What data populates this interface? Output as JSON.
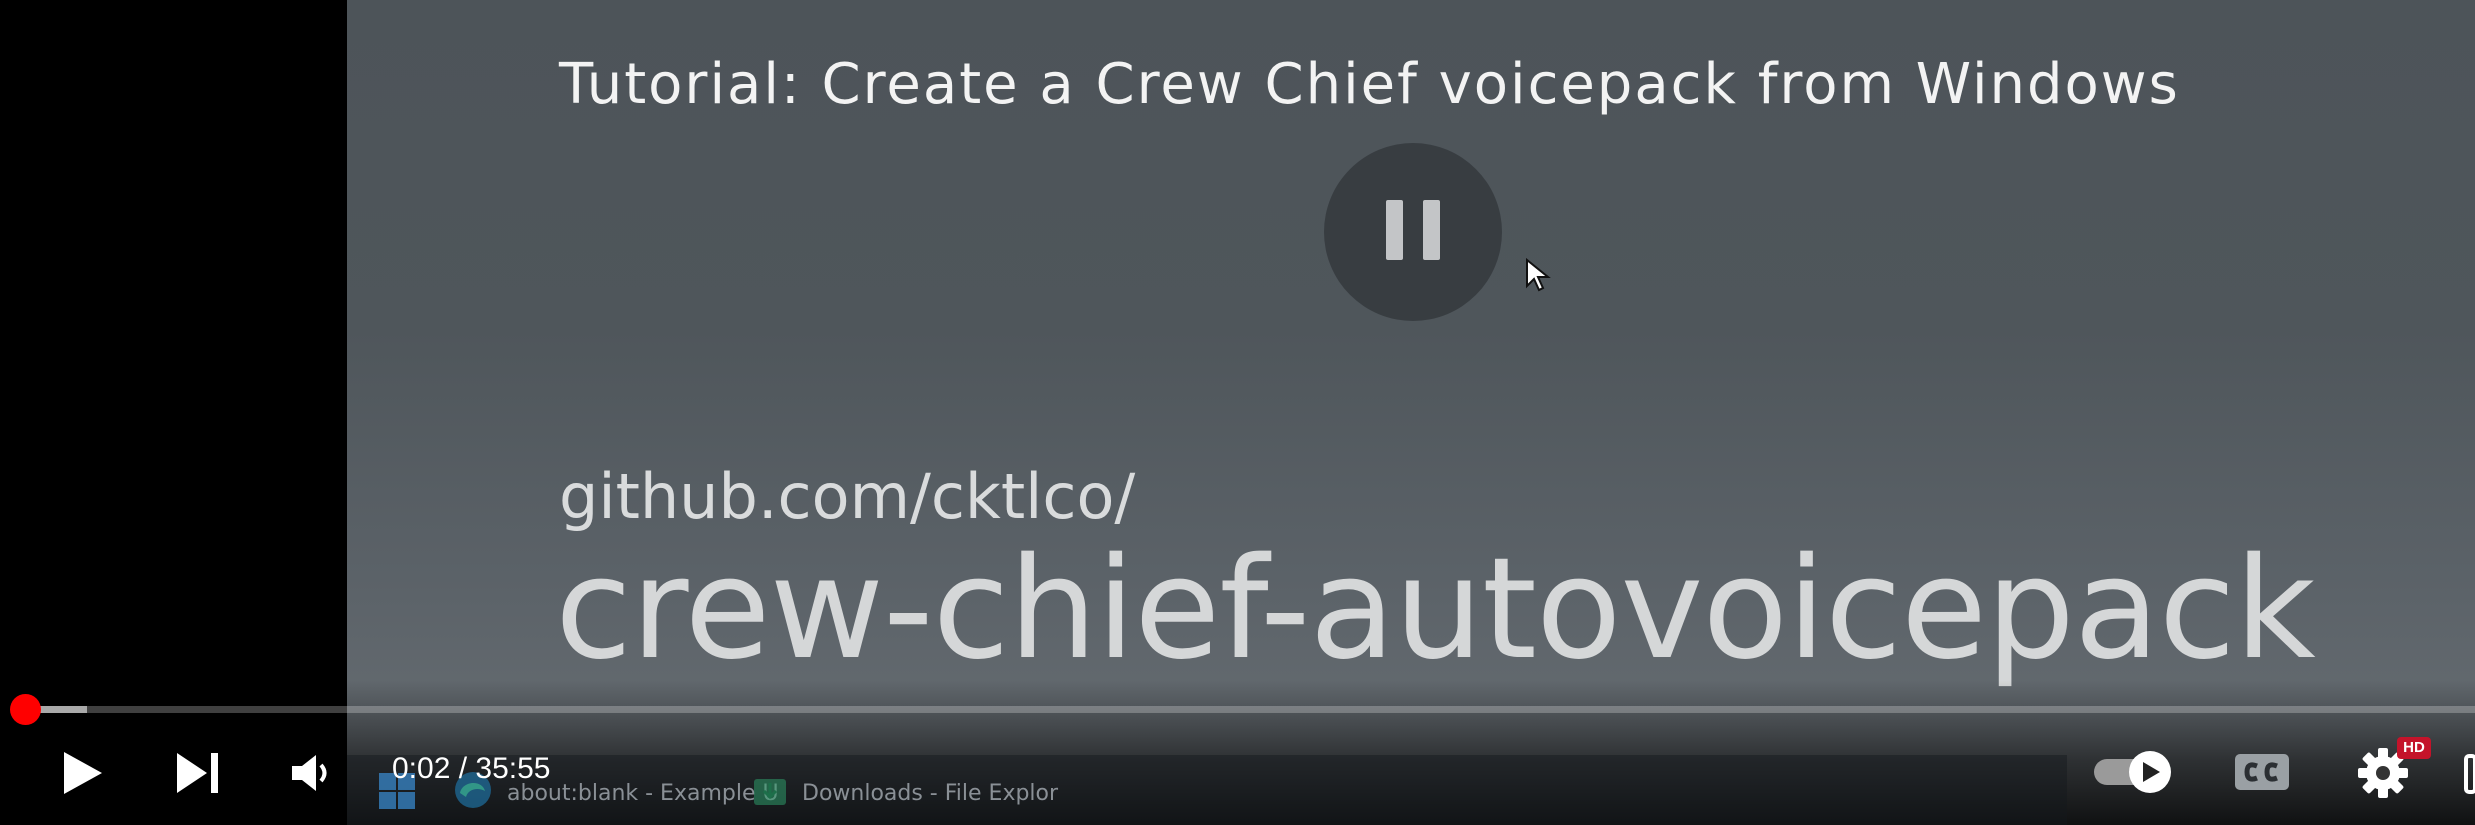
{
  "video": {
    "title": "Tutorial: Create a Crew Chief voicepack from Windows",
    "repo_prefix": "github.com/cktlco/",
    "repo_name": "crew-chief-autovoicepack"
  },
  "player": {
    "time_display": "0:02 / 35:55",
    "progress": {
      "played_fraction": 0.001,
      "loaded_fraction": 0.014
    },
    "hd_badge": "HD",
    "autoplay_on": true,
    "icons": {
      "play": "play-icon",
      "next": "next-icon",
      "volume": "volume-icon",
      "captions": "cc-icon",
      "settings": "gear-icon",
      "center_overlay": "pause-icon"
    },
    "accent_color": "#ff0000"
  },
  "taskbar": {
    "items": [
      {
        "label": "about:blank - Example U",
        "icon": "edge-browser-icon"
      },
      {
        "label": "Downloads - File Explor",
        "icon": "file-explorer-icon"
      }
    ],
    "start_icon": "windows-start-icon"
  }
}
